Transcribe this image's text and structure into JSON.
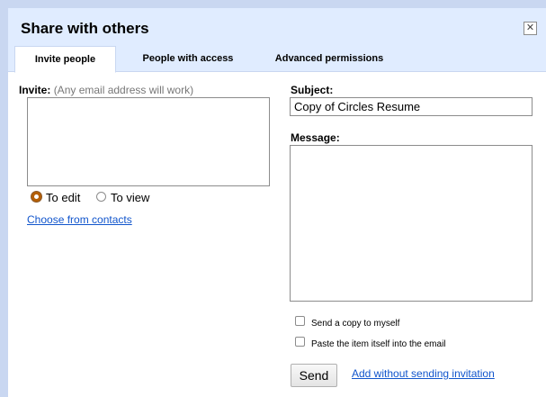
{
  "dialog": {
    "title": "Share with others",
    "close_glyph": "✕"
  },
  "tabs": [
    {
      "label": "Invite people",
      "active": true
    },
    {
      "label": "People with access",
      "active": false
    },
    {
      "label": "Advanced permissions",
      "active": false
    }
  ],
  "invite": {
    "label": "Invite:",
    "hint": "(Any email address will work)",
    "value": "",
    "permission_options": [
      {
        "label": "To edit",
        "selected": true
      },
      {
        "label": "To view",
        "selected": false
      }
    ],
    "choose_contacts_link": "Choose from contacts"
  },
  "subject": {
    "label": "Subject:",
    "value": "Copy of Circles Resume"
  },
  "message": {
    "label": "Message:",
    "value": ""
  },
  "options": [
    {
      "label": "Send a copy to myself",
      "checked": false
    },
    {
      "label": "Paste the item itself into the email",
      "checked": false
    }
  ],
  "actions": {
    "send_label": "Send",
    "add_without_sending_label": "Add without sending invitation"
  },
  "colors": {
    "header_bg": "#e0ecff",
    "border_blue": "#c9d7f1",
    "link": "#1155cc",
    "radio_selected": "#b45f06"
  }
}
